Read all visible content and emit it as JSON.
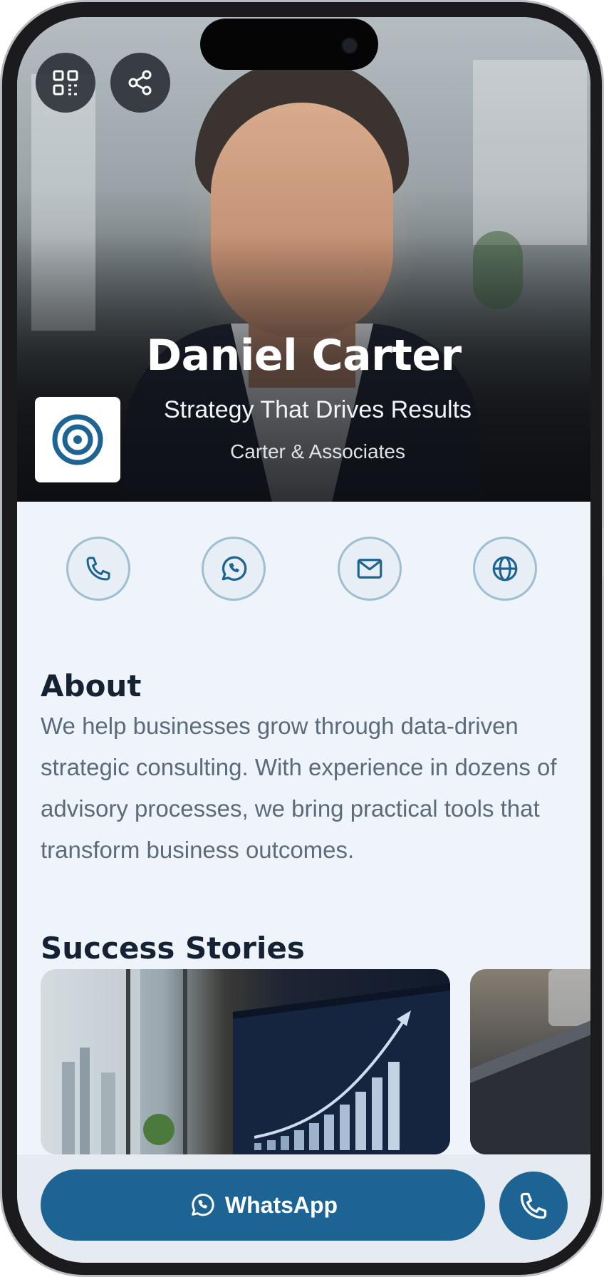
{
  "profile": {
    "name": "Daniel Carter",
    "tagline": "Strategy That Drives Results",
    "company": "Carter & Associates"
  },
  "header_actions": {
    "qr_icon": "qr-code-icon",
    "share_icon": "share-icon"
  },
  "contacts": [
    {
      "icon": "phone-icon"
    },
    {
      "icon": "whatsapp-icon"
    },
    {
      "icon": "mail-icon"
    },
    {
      "icon": "globe-icon"
    }
  ],
  "about": {
    "title": "About",
    "text": "We help businesses grow through data-driven strategic consulting. With experience in dozens of advisory processes, we bring practical tools that transform business outcomes."
  },
  "success_stories": {
    "title": "Success Stories"
  },
  "footer": {
    "whatsapp_label": "WhatsApp",
    "call_icon": "phone-icon"
  },
  "colors": {
    "primary": "#1d6494",
    "background": "#eef4fa",
    "heading": "#152234",
    "body_text": "#5b6b7c"
  }
}
